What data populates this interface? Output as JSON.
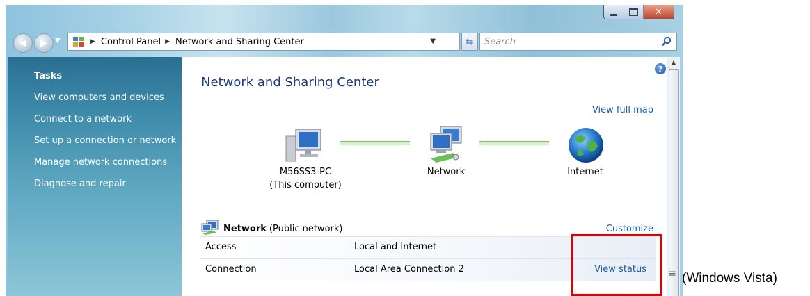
{
  "window": {
    "controls": {
      "minimize": "minimize",
      "maximize": "maximize",
      "close": "close"
    }
  },
  "address_bar": {
    "crumbs": [
      "Control Panel",
      "Network and Sharing Center"
    ],
    "search_placeholder": "Search"
  },
  "tasks": {
    "title": "Tasks",
    "items": [
      "View computers and devices",
      "Connect to a network",
      "Set up a connection or network",
      "Manage network connections",
      "Diagnose and repair"
    ]
  },
  "main": {
    "title": "Network and Sharing Center",
    "view_full_map": "View full map",
    "map": {
      "computer_name": "M56SS3-PC",
      "computer_sub": "(This computer)",
      "network": "Network",
      "internet": "Internet"
    },
    "network_section": {
      "name": "Network",
      "type": "(Public network)",
      "customize": "Customize",
      "rows": [
        {
          "label": "Access",
          "value": "Local and Internet",
          "link": ""
        },
        {
          "label": "Connection",
          "value": "Local Area Connection 2",
          "link": "View status"
        }
      ]
    }
  },
  "caption": "(Windows Vista)",
  "colors": {
    "link": "#1a5fa8",
    "title": "#1a3a7a",
    "highlight": "#e20000",
    "task_pane": "#3f8cab"
  },
  "icons": [
    "back-arrow-icon",
    "forward-arrow-icon",
    "control-panel-icon",
    "refresh-icon",
    "search-icon",
    "help-icon",
    "computer-icon",
    "network-icon",
    "globe-icon"
  ]
}
